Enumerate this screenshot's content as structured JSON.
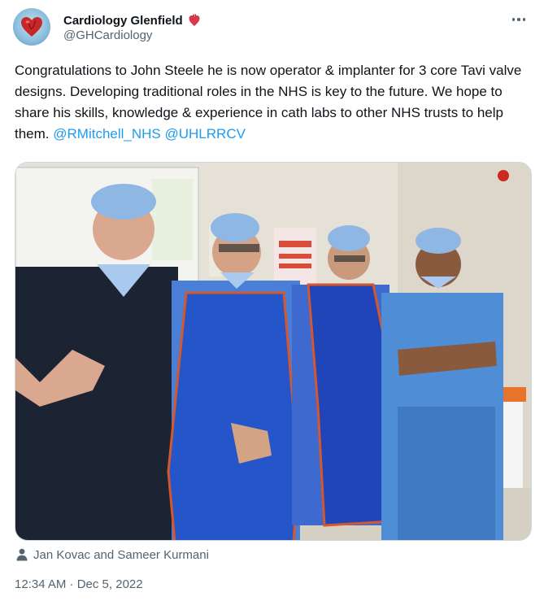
{
  "author": {
    "display_name": "Cardiology Glenfield",
    "handle": "@GHCardiology",
    "name_emoji": "anatomical-heart-emoji",
    "avatar": "heart-logo-avatar"
  },
  "tweet": {
    "text_main": "Congratulations to John Steele he is now operator & implanter for 3 core Tavi valve designs. Developing traditional roles in the NHS is key to the future. We hope to share his skills, knowledge & experience in cath labs to other NHS trusts to help them. ",
    "mentions": [
      "@RMitchell_NHS",
      "@UHLRRCV"
    ]
  },
  "media": {
    "description_icon": "photo-of-four-staff-in-scrubs"
  },
  "tagged": {
    "icon": "person-icon",
    "text": "Jan Kovac and Sameer Kurmani"
  },
  "meta": {
    "timestamp": "12:34 AM · Dec 5, 2022"
  },
  "colors": {
    "link": "#1d9bf0",
    "secondary_text": "#536471",
    "primary_text": "#0f1419"
  }
}
